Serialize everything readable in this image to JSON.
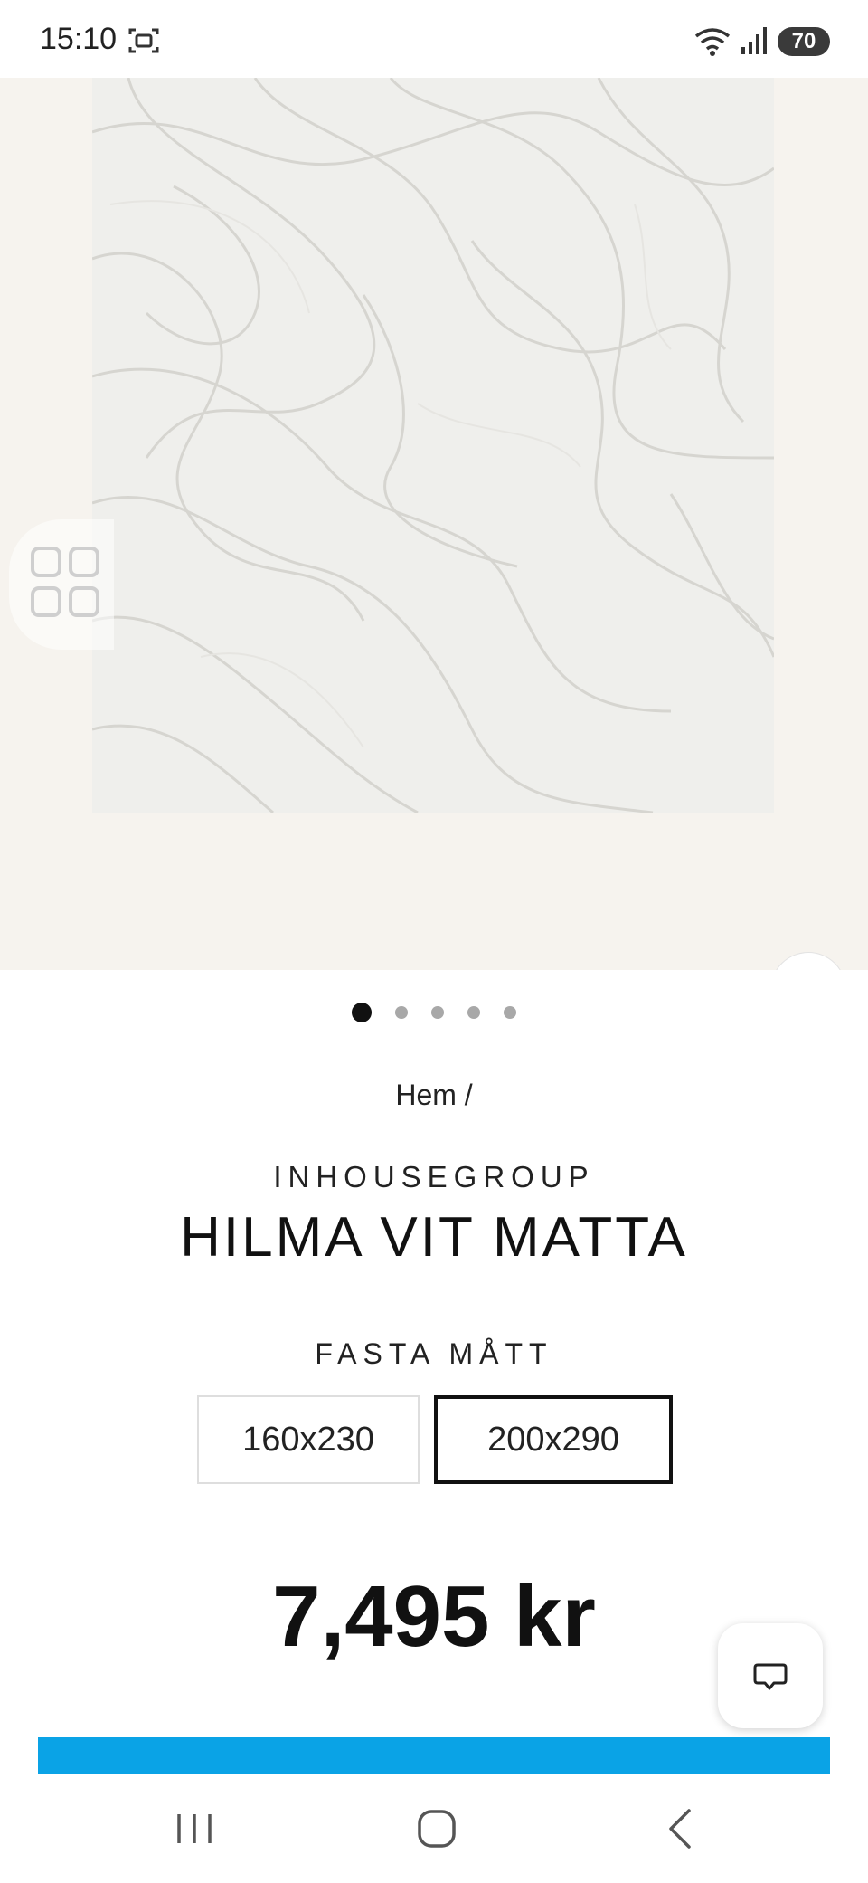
{
  "status_bar": {
    "time": "15:10",
    "battery": "70",
    "icons": [
      "screenshot-icon",
      "wifi-icon",
      "signal-icon",
      "battery-icon"
    ]
  },
  "gallery": {
    "image_subject": "white rug with wavy relief pattern",
    "slide_count": 5,
    "active_slide": 1,
    "background_color": "#f6f3ee"
  },
  "breadcrumb": "Hem /",
  "product": {
    "brand": "INHOUSEGROUP",
    "title": "HILMA VIT MATTA",
    "size_heading": "FASTA MÅTT",
    "sizes": [
      {
        "label": "160x230",
        "selected": false
      },
      {
        "label": "200x290",
        "selected": true
      }
    ],
    "price": "7,495 kr"
  },
  "colors": {
    "accent": "#0aa3e6",
    "text": "#111111"
  },
  "navigation": {
    "icons": [
      "recent-apps-icon",
      "home-icon",
      "back-icon"
    ]
  }
}
